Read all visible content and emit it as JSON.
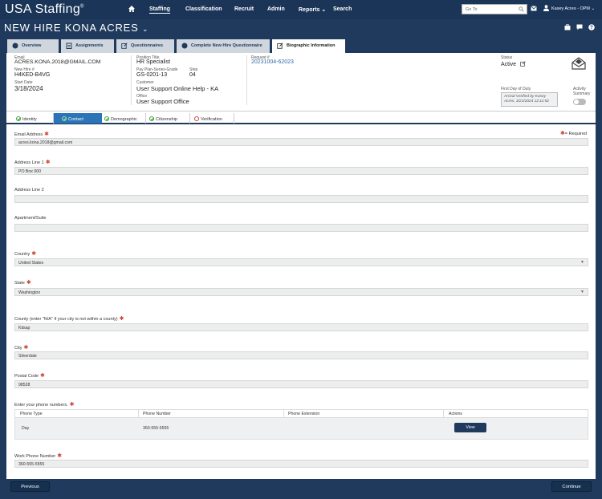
{
  "app": {
    "brand": "USA Staffing",
    "brand_mark": "®"
  },
  "nav": {
    "items": [
      {
        "label": "Staffing"
      },
      {
        "label": "Classification"
      },
      {
        "label": "Recruit"
      },
      {
        "label": "Admin"
      },
      {
        "label": "Reports ⌄"
      },
      {
        "label": "Search"
      }
    ],
    "goto_placeholder": "Go To",
    "user_name": "Kasey Acres - OPM ⌄"
  },
  "title": {
    "text": "NEW HIRE KONA ACRES",
    "caret": "⌄"
  },
  "tabs": [
    {
      "label": "Overview"
    },
    {
      "label": "Assignments"
    },
    {
      "label": "Questionnaires"
    },
    {
      "label": "Complete New Hire Questionnaire"
    },
    {
      "label": "Biographic Information"
    }
  ],
  "summary": {
    "email_label": "Email",
    "email": "ACRES.KONA.2018@GMAIL.COM",
    "newhire_label": "New Hire #",
    "newhire": "H4KED-B4VG",
    "start_label": "Start Date",
    "start": "3/18/2024",
    "position_label": "Position Title",
    "position": "HR Specialist",
    "ppsg_label": "Pay Plan-Series-Grade",
    "ppsg": "GS-0201-13",
    "step_label": "Step",
    "step": "04",
    "customer_label": "Customer",
    "customer": "User Support Online Help - KA",
    "office_label": "Office",
    "office": "User Support Office",
    "request_label": "Request #",
    "request": "20231004-62023",
    "status_label": "Status",
    "status": "Active",
    "fdod_label": "First Day of Duty",
    "arrival_note": "Arrival Verified by Kasey Acres, 3/21/2024 12:11:52",
    "activity_label_1": "Activity",
    "activity_label_2": "Summary"
  },
  "steps": [
    {
      "label": "Identity"
    },
    {
      "label": "Contact"
    },
    {
      "label": "Demographic"
    },
    {
      "label": "Citizenship"
    },
    {
      "label": "Verification"
    }
  ],
  "form": {
    "required_note": "= Required",
    "req_mark": "✱",
    "email_label": "Email Address",
    "email_value": "acres.kona.2018@gmail.com",
    "addr1_label": "Address Line 1",
    "addr1_value": "PO Box 000",
    "addr2_label": "Address Line 2",
    "addr2_value": "",
    "apt_label": "Apartment/Suite",
    "apt_value": "",
    "country_label": "Country",
    "country_value": "United States",
    "state_label": "State",
    "state_value": "Washington",
    "county_label": "County (enter \"N/A\" if your city is not within a county)",
    "county_value": "Kitsap",
    "city_label": "City",
    "city_value": "Silverdale",
    "postal_label": "Postal Code",
    "postal_value": "98528",
    "phones_label": "Enter your phone numbers.",
    "work_phone_label": "Work Phone Number",
    "work_phone_value": "360-555-5555"
  },
  "phone_table": {
    "headers": [
      "Phone Type",
      "Phone Number",
      "Phone Extension",
      "Actions"
    ],
    "rows": [
      {
        "type": "Day",
        "number": "360-555-5555",
        "extension": "",
        "action": "View"
      }
    ]
  },
  "footer": {
    "previous": "Previous",
    "continue": "Continue"
  }
}
